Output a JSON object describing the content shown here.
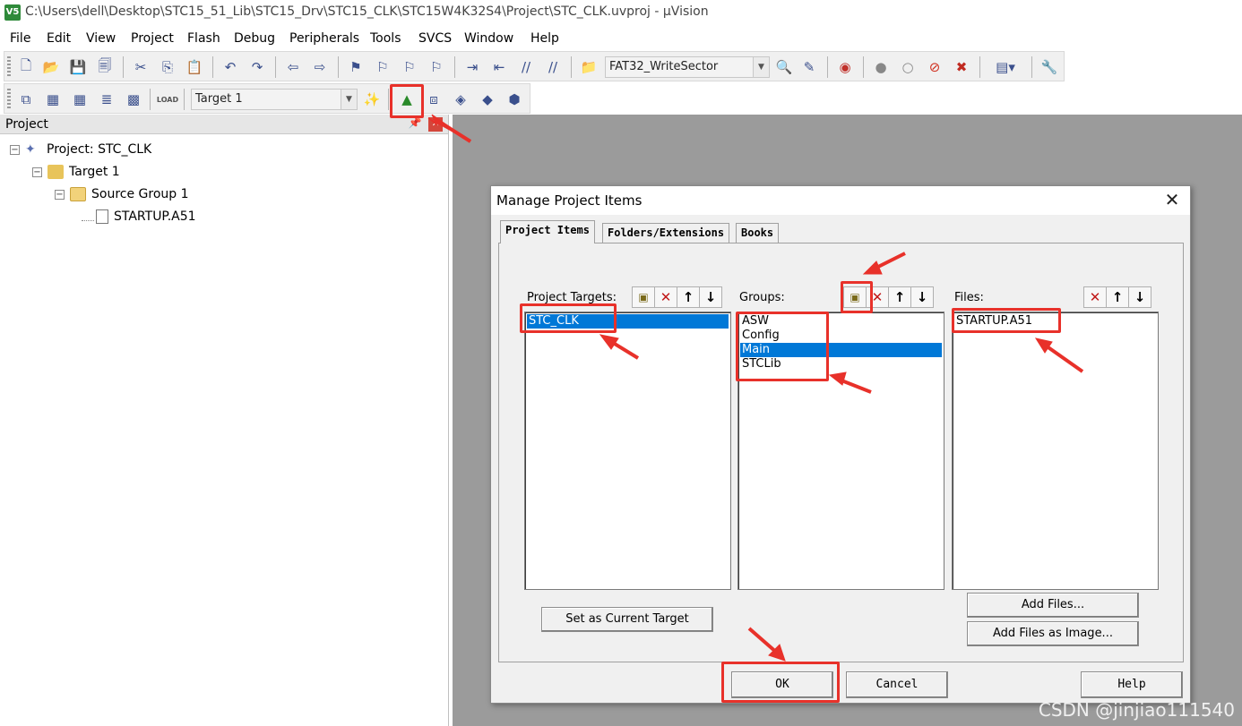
{
  "window": {
    "title": "C:\\Users\\dell\\Desktop\\STC15_51_Lib\\STC15_Drv\\STC15_CLK\\STC15W4K32S4\\Project\\STC_CLK.uvproj - µVision",
    "icon_name": "uvision-app-icon"
  },
  "menu": [
    "File",
    "Edit",
    "View",
    "Project",
    "Flash",
    "Debug",
    "Peripherals",
    "Tools",
    "SVCS",
    "Window",
    "Help"
  ],
  "toolbar": {
    "find_combo_value": "FAT32_WriteSector",
    "target_combo_value": "Target 1",
    "load_label": "LOAD"
  },
  "project_panel": {
    "title": "Project",
    "tree": {
      "project": "Project: STC_CLK",
      "target": "Target 1",
      "group": "Source Group 1",
      "file": "STARTUP.A51"
    }
  },
  "dialog": {
    "title": "Manage Project Items",
    "tabs": [
      "Project Items",
      "Folders/Extensions",
      "Books"
    ],
    "active_tab": "Project Items",
    "targets": {
      "label": "Project Targets:",
      "items": [
        "STC_CLK"
      ],
      "selected": "STC_CLK"
    },
    "groups": {
      "label": "Groups:",
      "items": [
        "ASW",
        "Config",
        "Main",
        "STCLib"
      ],
      "selected": "Main"
    },
    "files": {
      "label": "Files:",
      "items": [
        "STARTUP.A51"
      ]
    },
    "buttons": {
      "set_current": "Set as Current Target",
      "add_files": "Add Files...",
      "add_files_image": "Add Files as Image...",
      "ok": "OK",
      "cancel": "Cancel",
      "help": "Help"
    }
  },
  "annotation_color": "#e8312a",
  "selection_color": "#0078d7",
  "watermark": "CSDN @jinjiao111540"
}
